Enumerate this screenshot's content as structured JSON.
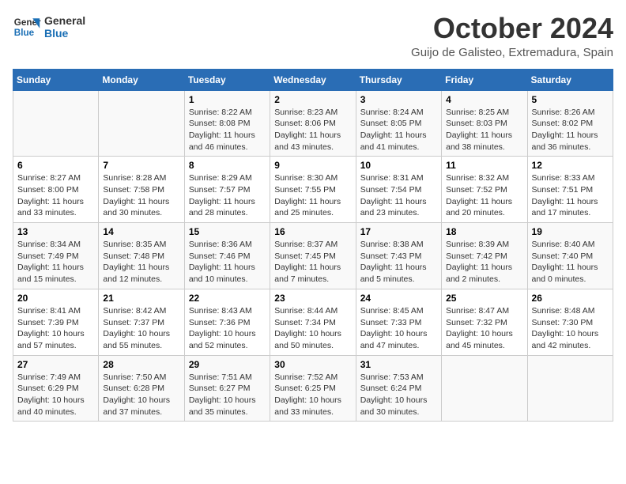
{
  "header": {
    "logo_line1": "General",
    "logo_line2": "Blue",
    "month": "October 2024",
    "location": "Guijo de Galisteo, Extremadura, Spain"
  },
  "days_of_week": [
    "Sunday",
    "Monday",
    "Tuesday",
    "Wednesday",
    "Thursday",
    "Friday",
    "Saturday"
  ],
  "weeks": [
    [
      {
        "day": "",
        "info": ""
      },
      {
        "day": "",
        "info": ""
      },
      {
        "day": "1",
        "info": "Sunrise: 8:22 AM\nSunset: 8:08 PM\nDaylight: 11 hours\nand 46 minutes."
      },
      {
        "day": "2",
        "info": "Sunrise: 8:23 AM\nSunset: 8:06 PM\nDaylight: 11 hours\nand 43 minutes."
      },
      {
        "day": "3",
        "info": "Sunrise: 8:24 AM\nSunset: 8:05 PM\nDaylight: 11 hours\nand 41 minutes."
      },
      {
        "day": "4",
        "info": "Sunrise: 8:25 AM\nSunset: 8:03 PM\nDaylight: 11 hours\nand 38 minutes."
      },
      {
        "day": "5",
        "info": "Sunrise: 8:26 AM\nSunset: 8:02 PM\nDaylight: 11 hours\nand 36 minutes."
      }
    ],
    [
      {
        "day": "6",
        "info": "Sunrise: 8:27 AM\nSunset: 8:00 PM\nDaylight: 11 hours\nand 33 minutes."
      },
      {
        "day": "7",
        "info": "Sunrise: 8:28 AM\nSunset: 7:58 PM\nDaylight: 11 hours\nand 30 minutes."
      },
      {
        "day": "8",
        "info": "Sunrise: 8:29 AM\nSunset: 7:57 PM\nDaylight: 11 hours\nand 28 minutes."
      },
      {
        "day": "9",
        "info": "Sunrise: 8:30 AM\nSunset: 7:55 PM\nDaylight: 11 hours\nand 25 minutes."
      },
      {
        "day": "10",
        "info": "Sunrise: 8:31 AM\nSunset: 7:54 PM\nDaylight: 11 hours\nand 23 minutes."
      },
      {
        "day": "11",
        "info": "Sunrise: 8:32 AM\nSunset: 7:52 PM\nDaylight: 11 hours\nand 20 minutes."
      },
      {
        "day": "12",
        "info": "Sunrise: 8:33 AM\nSunset: 7:51 PM\nDaylight: 11 hours\nand 17 minutes."
      }
    ],
    [
      {
        "day": "13",
        "info": "Sunrise: 8:34 AM\nSunset: 7:49 PM\nDaylight: 11 hours\nand 15 minutes."
      },
      {
        "day": "14",
        "info": "Sunrise: 8:35 AM\nSunset: 7:48 PM\nDaylight: 11 hours\nand 12 minutes."
      },
      {
        "day": "15",
        "info": "Sunrise: 8:36 AM\nSunset: 7:46 PM\nDaylight: 11 hours\nand 10 minutes."
      },
      {
        "day": "16",
        "info": "Sunrise: 8:37 AM\nSunset: 7:45 PM\nDaylight: 11 hours\nand 7 minutes."
      },
      {
        "day": "17",
        "info": "Sunrise: 8:38 AM\nSunset: 7:43 PM\nDaylight: 11 hours\nand 5 minutes."
      },
      {
        "day": "18",
        "info": "Sunrise: 8:39 AM\nSunset: 7:42 PM\nDaylight: 11 hours\nand 2 minutes."
      },
      {
        "day": "19",
        "info": "Sunrise: 8:40 AM\nSunset: 7:40 PM\nDaylight: 11 hours\nand 0 minutes."
      }
    ],
    [
      {
        "day": "20",
        "info": "Sunrise: 8:41 AM\nSunset: 7:39 PM\nDaylight: 10 hours\nand 57 minutes."
      },
      {
        "day": "21",
        "info": "Sunrise: 8:42 AM\nSunset: 7:37 PM\nDaylight: 10 hours\nand 55 minutes."
      },
      {
        "day": "22",
        "info": "Sunrise: 8:43 AM\nSunset: 7:36 PM\nDaylight: 10 hours\nand 52 minutes."
      },
      {
        "day": "23",
        "info": "Sunrise: 8:44 AM\nSunset: 7:34 PM\nDaylight: 10 hours\nand 50 minutes."
      },
      {
        "day": "24",
        "info": "Sunrise: 8:45 AM\nSunset: 7:33 PM\nDaylight: 10 hours\nand 47 minutes."
      },
      {
        "day": "25",
        "info": "Sunrise: 8:47 AM\nSunset: 7:32 PM\nDaylight: 10 hours\nand 45 minutes."
      },
      {
        "day": "26",
        "info": "Sunrise: 8:48 AM\nSunset: 7:30 PM\nDaylight: 10 hours\nand 42 minutes."
      }
    ],
    [
      {
        "day": "27",
        "info": "Sunrise: 7:49 AM\nSunset: 6:29 PM\nDaylight: 10 hours\nand 40 minutes."
      },
      {
        "day": "28",
        "info": "Sunrise: 7:50 AM\nSunset: 6:28 PM\nDaylight: 10 hours\nand 37 minutes."
      },
      {
        "day": "29",
        "info": "Sunrise: 7:51 AM\nSunset: 6:27 PM\nDaylight: 10 hours\nand 35 minutes."
      },
      {
        "day": "30",
        "info": "Sunrise: 7:52 AM\nSunset: 6:25 PM\nDaylight: 10 hours\nand 33 minutes."
      },
      {
        "day": "31",
        "info": "Sunrise: 7:53 AM\nSunset: 6:24 PM\nDaylight: 10 hours\nand 30 minutes."
      },
      {
        "day": "",
        "info": ""
      },
      {
        "day": "",
        "info": ""
      }
    ]
  ]
}
